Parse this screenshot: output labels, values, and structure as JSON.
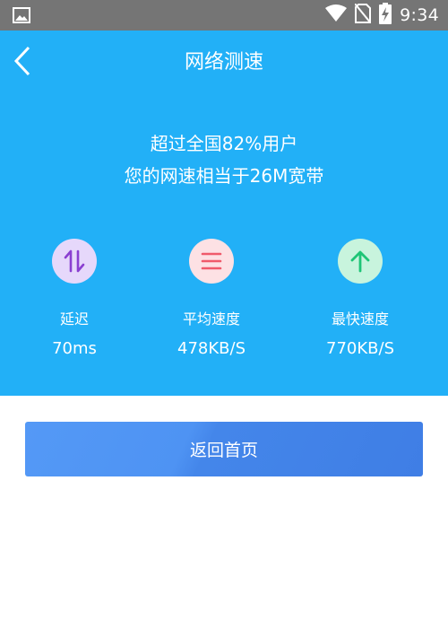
{
  "status_bar": {
    "time": "9:34",
    "icons": [
      "gallery-icon",
      "wifi-icon",
      "no-sim-icon",
      "battery-charging-icon"
    ]
  },
  "header": {
    "title": "网络测速",
    "back_icon": "chevron-left-icon"
  },
  "summary": {
    "line1": "超过全国82%用户",
    "line2": "您的网速相当于26M宽带"
  },
  "stats": [
    {
      "icon": "up-down-arrows-icon",
      "label": "延迟",
      "value": "70ms",
      "color": "#8a3fd1",
      "bg": "#e6d8fb"
    },
    {
      "icon": "menu-lines-icon",
      "label": "平均速度",
      "value": "478KB/S",
      "color": "#f05a6b",
      "bg": "#fde1e4"
    },
    {
      "icon": "arrow-up-icon",
      "label": "最快速度",
      "value": "770KB/S",
      "color": "#1ec576",
      "bg": "#c8f4dd"
    }
  ],
  "actions": {
    "home_label": "返回首页"
  },
  "colors": {
    "hero_bg": "#22b0f7",
    "status_bar_bg": "#757575",
    "button_gradient": [
      "#5499f6",
      "#3f7ee5"
    ]
  }
}
